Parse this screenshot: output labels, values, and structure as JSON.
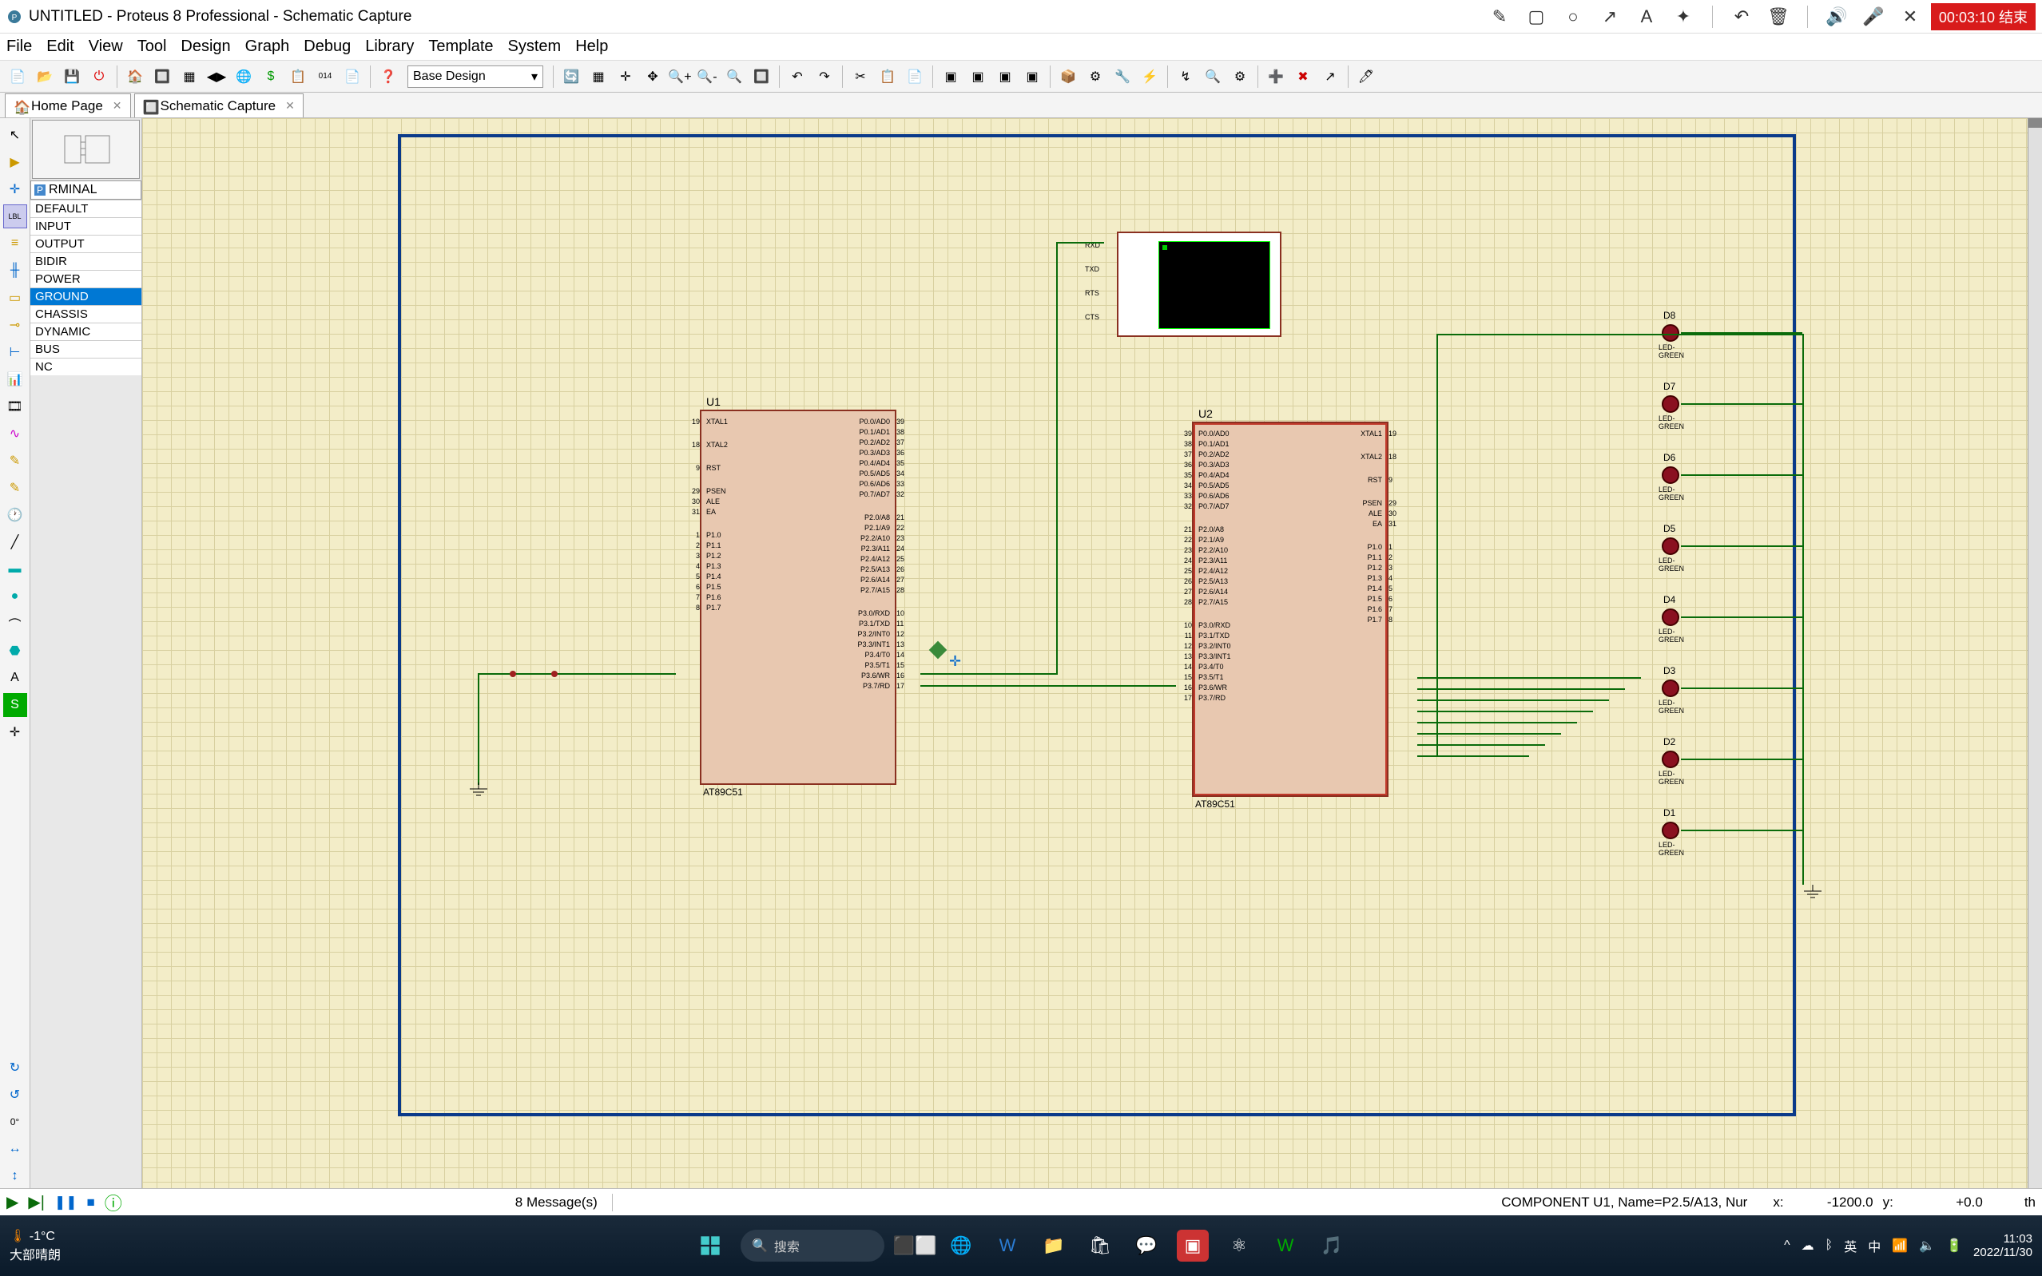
{
  "titlebar": {
    "title": "UNTITLED - Proteus 8 Professional - Schematic Capture",
    "timer": "00:03:10 结束"
  },
  "menu": [
    "File",
    "Edit",
    "View",
    "Tool",
    "Design",
    "Graph",
    "Debug",
    "Library",
    "Template",
    "System",
    "Help"
  ],
  "toolbar": {
    "combo": "Base Design"
  },
  "tabs": [
    {
      "icon": "home",
      "label": "Home Page"
    },
    {
      "icon": "schem",
      "label": "Schematic Capture",
      "active": true
    }
  ],
  "devpanel": {
    "header": "RMINAL",
    "header_prefix": "P",
    "items": [
      "DEFAULT",
      "INPUT",
      "OUTPUT",
      "BIDIR",
      "POWER",
      "GROUND",
      "CHASSIS",
      "DYNAMIC",
      "BUS",
      "NC"
    ],
    "selected": "GROUND"
  },
  "schematic": {
    "U1": {
      "ref": "U1",
      "part": "AT89C51"
    },
    "U2": {
      "ref": "U2",
      "part": "AT89C51"
    },
    "vterm_pins": [
      "RXD",
      "TXD",
      "RTS",
      "CTS"
    ],
    "leds": [
      {
        "ref": "D8",
        "part": "LED-GREEN"
      },
      {
        "ref": "D7",
        "part": "LED-GREEN"
      },
      {
        "ref": "D6",
        "part": "LED-GREEN"
      },
      {
        "ref": "D5",
        "part": "LED-GREEN"
      },
      {
        "ref": "D4",
        "part": "LED-GREEN"
      },
      {
        "ref": "D3",
        "part": "LED-GREEN"
      },
      {
        "ref": "D2",
        "part": "LED-GREEN"
      },
      {
        "ref": "D1",
        "part": "LED-GREEN"
      }
    ],
    "chip_pins": {
      "left_top": [
        {
          "num": "19",
          "name": "XTAL1"
        },
        {
          "num": "18",
          "name": "XTAL2"
        },
        {
          "num": "9",
          "name": "RST"
        },
        {
          "num": "29",
          "name": "PSEN"
        },
        {
          "num": "30",
          "name": "ALE"
        },
        {
          "num": "31",
          "name": "EA"
        },
        {
          "num": "1",
          "name": "P1.0"
        },
        {
          "num": "2",
          "name": "P1.1"
        },
        {
          "num": "3",
          "name": "P1.2"
        },
        {
          "num": "4",
          "name": "P1.3"
        },
        {
          "num": "5",
          "name": "P1.4"
        },
        {
          "num": "6",
          "name": "P1.5"
        },
        {
          "num": "7",
          "name": "P1.6"
        },
        {
          "num": "8",
          "name": "P1.7"
        }
      ],
      "right_top": [
        {
          "num": "39",
          "name": "P0.0/AD0"
        },
        {
          "num": "38",
          "name": "P0.1/AD1"
        },
        {
          "num": "37",
          "name": "P0.2/AD2"
        },
        {
          "num": "36",
          "name": "P0.3/AD3"
        },
        {
          "num": "35",
          "name": "P0.4/AD4"
        },
        {
          "num": "34",
          "name": "P0.5/AD5"
        },
        {
          "num": "33",
          "name": "P0.6/AD6"
        },
        {
          "num": "32",
          "name": "P0.7/AD7"
        },
        {
          "num": "21",
          "name": "P2.0/A8"
        },
        {
          "num": "22",
          "name": "P2.1/A9"
        },
        {
          "num": "23",
          "name": "P2.2/A10"
        },
        {
          "num": "24",
          "name": "P2.3/A11"
        },
        {
          "num": "25",
          "name": "P2.4/A12"
        },
        {
          "num": "26",
          "name": "P2.5/A13"
        },
        {
          "num": "27",
          "name": "P2.6/A14"
        },
        {
          "num": "28",
          "name": "P2.7/A15"
        },
        {
          "num": "10",
          "name": "P3.0/RXD"
        },
        {
          "num": "11",
          "name": "P3.1/TXD"
        },
        {
          "num": "12",
          "name": "P3.2/INT0"
        },
        {
          "num": "13",
          "name": "P3.3/INT1"
        },
        {
          "num": "14",
          "name": "P3.4/T0"
        },
        {
          "num": "15",
          "name": "P3.5/T1"
        },
        {
          "num": "16",
          "name": "P3.6/WR"
        },
        {
          "num": "17",
          "name": "P3.7/RD"
        }
      ]
    }
  },
  "rotation_display": "0°",
  "status": {
    "messages": "8 Message(s)",
    "component": "COMPONENT U1, Name=P2.5/A13, Nur",
    "x_label": "x:",
    "x_val": "-1200.0",
    "y_label": "y:",
    "y_val": "+0.0",
    "right": "th"
  },
  "taskbar": {
    "temp": "-1°C",
    "weather": "大部晴朗",
    "search": "搜索",
    "ime1": "英",
    "ime2": "中",
    "time": "11:03",
    "date": "2022/11/30"
  }
}
